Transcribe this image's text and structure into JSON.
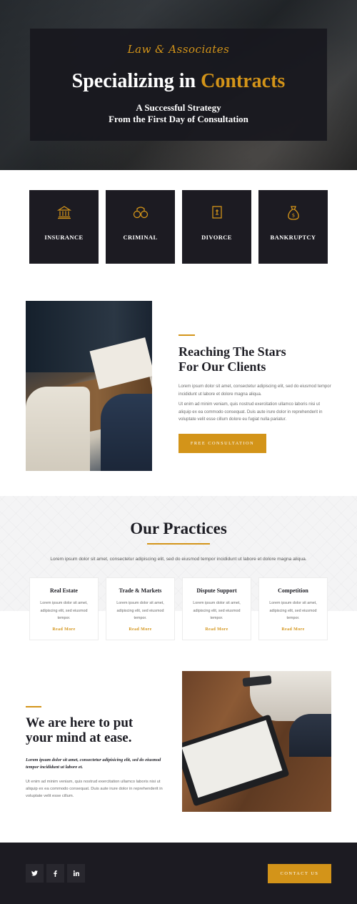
{
  "colors": {
    "accent": "#d39419",
    "dark": "#1c1b22",
    "light_bg": "#f4f4f5"
  },
  "hero": {
    "brand": "Law & Associates",
    "title_main": "Specializing in ",
    "title_accent": "Contracts",
    "subtitle_line1": "A Successful Strategy",
    "subtitle_line2": "From the First Day of Consultation"
  },
  "services": [
    {
      "label": "INSURANCE",
      "icon": "bank-building-icon"
    },
    {
      "label": "CRIMINAL",
      "icon": "handcuffs-icon"
    },
    {
      "label": "DIVORCE",
      "icon": "document-card-icon"
    },
    {
      "label": "BANKRUPTCY",
      "icon": "money-bag-icon"
    }
  ],
  "about": {
    "title": "Reaching The Stars\nFor Our Clients",
    "paragraph1": "Lorem ipsum dolor sit amet, consectetur adipiscing elit, sed do eiusmod tempor incididunt ut labore et dolore magna aliqua.",
    "paragraph2": "Ut enim ad minim veniam, quis nostrud exercitation ullamco laboris nisi ut aliquip ex ea commodo consequat. Duis aute irure dolor in reprehenderit in voluptate velit esse cillum dolore eu fugiat nulla pariatur.",
    "button_label": "FREE CONSULTATION"
  },
  "practices": {
    "title": "Our Practices",
    "intro": "Lorem ipsum dolor sit amet, consectetur adipiscing elit, sed do eiusmod tempor incididunt ut labore et dolore magna aliqua.",
    "items": [
      {
        "title": "Real Estate",
        "text": "Lorem ipsum dolor sit amet, adipiscing elit, sed eiusmod tempor.",
        "link": "Read More"
      },
      {
        "title": "Trade & Markets",
        "text": "Lorem ipsum dolor sit amet, adipiscing elit, sed eiusmod tempor.",
        "link": "Read More"
      },
      {
        "title": "Dispute Support",
        "text": "Lorem ipsum dolor sit amet, adipiscing elit, sed eiusmod tempor.",
        "link": "Read More"
      },
      {
        "title": "Competition",
        "text": "Lorem ipsum dolor sit amet, adipiscing elit, sed eiusmod tempor.",
        "link": "Read More"
      }
    ]
  },
  "ease": {
    "title": "We are here to put\nyour mind at ease.",
    "lead": "Lorem ipsum dolor sit amet, consectetur adipisicing elit, sed do eiusmod tempor incididunt ut labore et.",
    "body": "Ut enim ad minim veniam, quis nostrud exercitation ullamco laboris nisi ut aliquip ex ea commodo consequat. Duis aute irure dolor in reprehenderit in voluptate velit esse cillum."
  },
  "footer": {
    "social": [
      "twitter-icon",
      "facebook-icon",
      "linkedin-icon"
    ],
    "contact_label": "CONTACT US"
  }
}
